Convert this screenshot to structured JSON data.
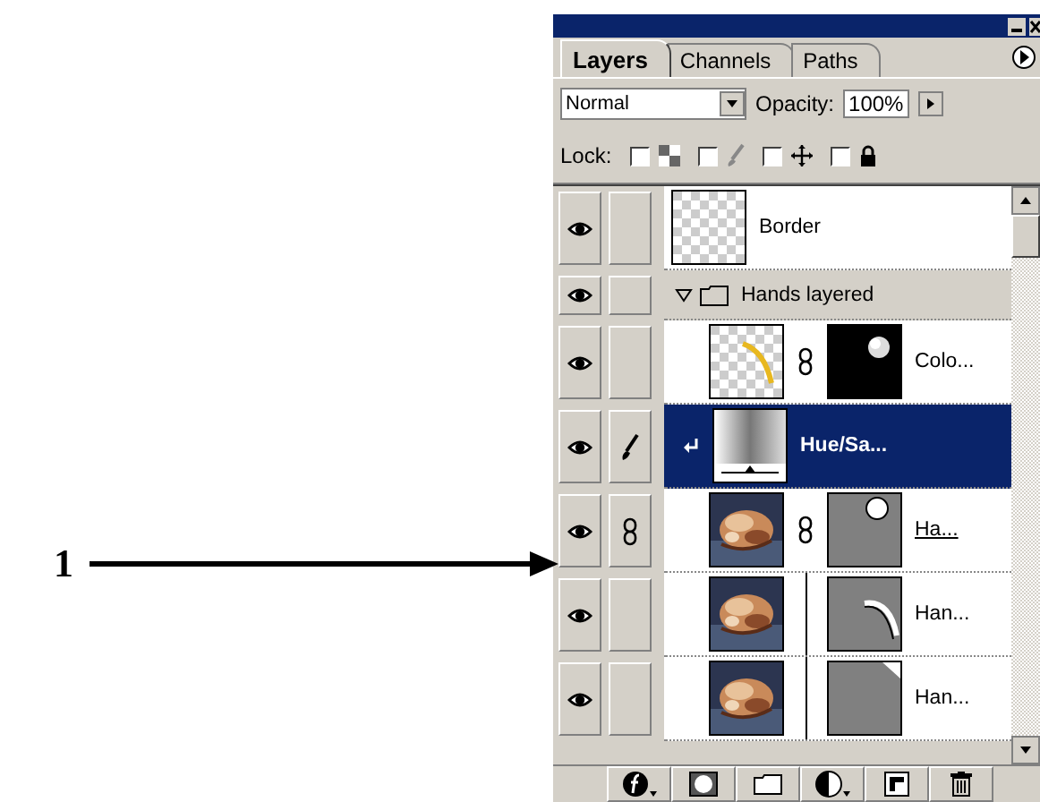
{
  "tabs": [
    {
      "label": "Layers",
      "selected": true
    },
    {
      "label": "Channels",
      "selected": false
    },
    {
      "label": "Paths",
      "selected": false
    }
  ],
  "blend_mode": {
    "value": "Normal"
  },
  "opacity": {
    "label": "Opacity:",
    "value": "100%"
  },
  "lock": {
    "label": "Lock:",
    "options": [
      {
        "kind": "transparency",
        "checked": false
      },
      {
        "kind": "brush",
        "checked": false
      },
      {
        "kind": "move",
        "checked": false
      },
      {
        "kind": "all",
        "checked": false
      }
    ]
  },
  "layers": [
    {
      "kind": "layer",
      "name": "Border",
      "visible": true,
      "selected": false,
      "linked": false,
      "painting": false,
      "clipped": false,
      "name_underlined": false,
      "thumbnail": {
        "kind": "transparent"
      }
    },
    {
      "kind": "group",
      "name": "Hands layered",
      "visible": true,
      "selected": false,
      "linked": false,
      "painting": false,
      "expanded": true,
      "children": [
        {
          "kind": "layer",
          "name": "Colo...",
          "visible": true,
          "selected": false,
          "linked": false,
          "painting": false,
          "clipped": false,
          "name_underlined": false,
          "thumbnail": {
            "kind": "stroke"
          },
          "mask": {
            "kind": "blob",
            "linked": true
          }
        },
        {
          "kind": "adjustment",
          "name": "Hue/Sa...",
          "visible": true,
          "selected": true,
          "linked": false,
          "painting": true,
          "clipped": true,
          "name_underlined": false
        },
        {
          "kind": "layer",
          "name": "Ha...",
          "visible": true,
          "selected": false,
          "linked": true,
          "painting": false,
          "clipped": false,
          "name_underlined": true,
          "mask": {
            "kind": "circle",
            "linked": true
          }
        },
        {
          "kind": "layer",
          "name": "Han...",
          "visible": true,
          "selected": false,
          "linked": false,
          "painting": false,
          "clipped": false,
          "name_underlined": false,
          "mask": {
            "kind": "curve",
            "linked": false
          }
        },
        {
          "kind": "layer",
          "name": "Han...",
          "visible": true,
          "selected": false,
          "linked": false,
          "painting": false,
          "clipped": false,
          "name_underlined": false,
          "mask": {
            "kind": "corner",
            "linked": false
          }
        }
      ]
    }
  ],
  "annotation": {
    "label": "1"
  }
}
